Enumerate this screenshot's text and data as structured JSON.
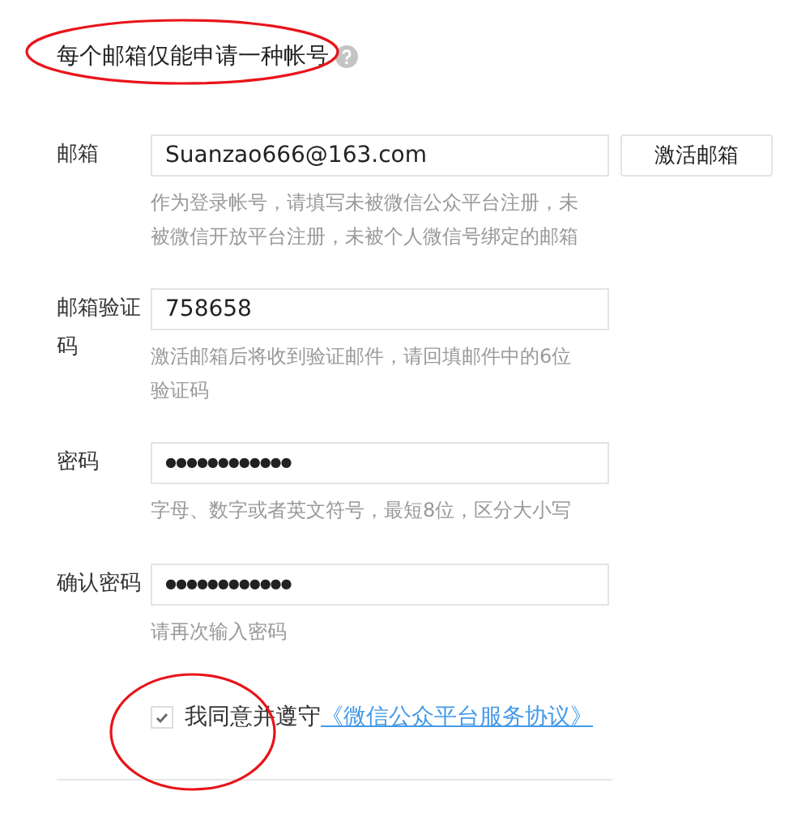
{
  "notice": {
    "text": "每个邮箱仅能申请一种帐号"
  },
  "fields": [
    {
      "label": "邮箱",
      "masked": false,
      "value": "Suanzao666@163.com",
      "hint": "作为登录帐号，请填写未被微信公众平台注册，未被微信开放平台注册，未被个人微信号绑定的邮箱",
      "button": "激活邮箱"
    },
    {
      "label": "邮箱验证码",
      "masked": false,
      "value": "758658",
      "hint": "激活邮箱后将收到验证邮件，请回填邮件中的6位验证码"
    },
    {
      "label": "密码",
      "masked": true,
      "value": "●●●●●●●●●●●●",
      "hint": "字母、数字或者英文符号，最短8位，区分大小写"
    },
    {
      "label": "确认密码",
      "masked": true,
      "value": "●●●●●●●●●●●●",
      "hint": "请再次输入密码"
    }
  ],
  "agreement": {
    "checked": true,
    "text": "我同意并遵守",
    "link": "《微信公众平台服务协议》"
  },
  "highlight_circles": [
    {
      "kind": "ellipse"
    },
    {
      "kind": "ellipse"
    }
  ]
}
